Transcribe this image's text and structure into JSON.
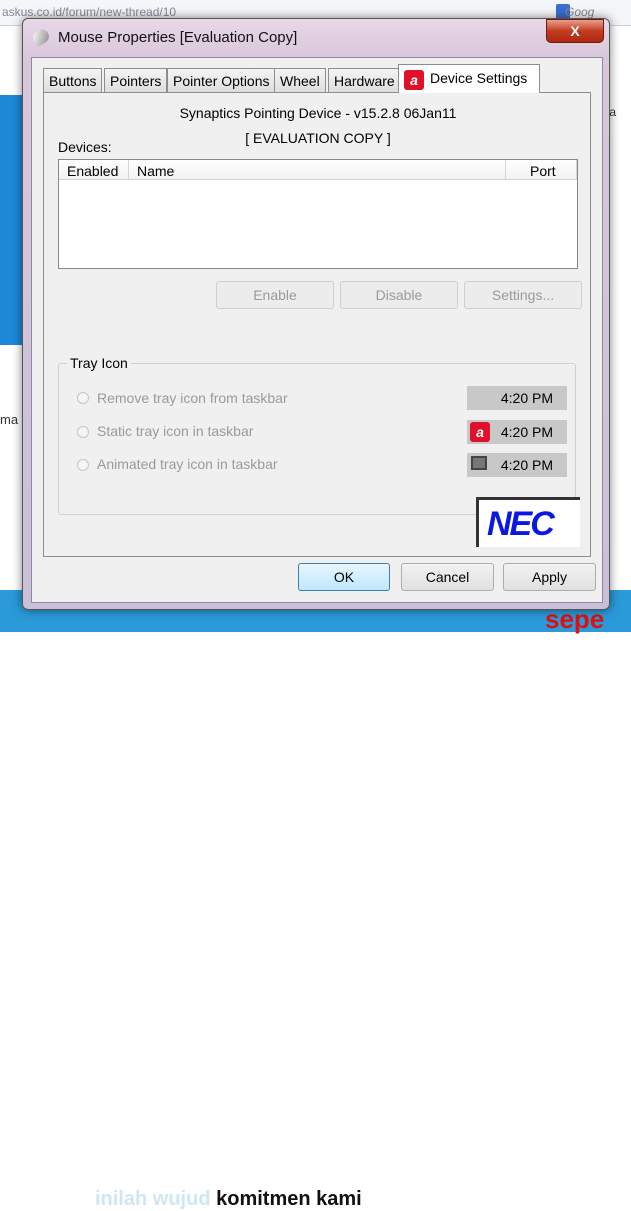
{
  "browser": {
    "url": "askus.co.id/forum/new-thread/10",
    "search": "Goog",
    "side_text": "sta",
    "left_text": "ma",
    "banner_light": "inilah wujud",
    "banner_dark": "komitmen kami",
    "banner_red": "sepe"
  },
  "window": {
    "title": "Mouse Properties [Evaluation Copy]",
    "close_label": "X"
  },
  "tabs": [
    {
      "label": "Buttons"
    },
    {
      "label": "Pointers"
    },
    {
      "label": "Pointer Options"
    },
    {
      "label": "Wheel"
    },
    {
      "label": "Hardware"
    },
    {
      "label": "Device Settings",
      "active": true
    }
  ],
  "device_settings": {
    "device_title": "Synaptics Pointing Device - v15.2.8 06Jan11",
    "evaluation": "[ EVALUATION COPY ]",
    "devices_label": "Devices:",
    "columns": [
      "Enabled",
      "Name",
      "Port"
    ],
    "rows": [],
    "buttons": {
      "enable": "Enable",
      "disable": "Disable",
      "settings": "Settings..."
    },
    "tray": {
      "label": "Tray Icon",
      "options": [
        {
          "label": "Remove tray icon from taskbar",
          "clock": "4:20 PM",
          "icon": "none"
        },
        {
          "label": "Static tray icon in taskbar",
          "clock": "4:20 PM",
          "icon": "synaptics-icon"
        },
        {
          "label": "Animated tray icon in taskbar",
          "clock": "4:20 PM",
          "icon": "monitor-icon"
        }
      ]
    },
    "logo": "NEC"
  },
  "footer": {
    "ok": "OK",
    "cancel": "Cancel",
    "apply": "Apply"
  },
  "colors": {
    "synaptics_red": "#e0102a",
    "nec_blue": "#0a18e0"
  }
}
